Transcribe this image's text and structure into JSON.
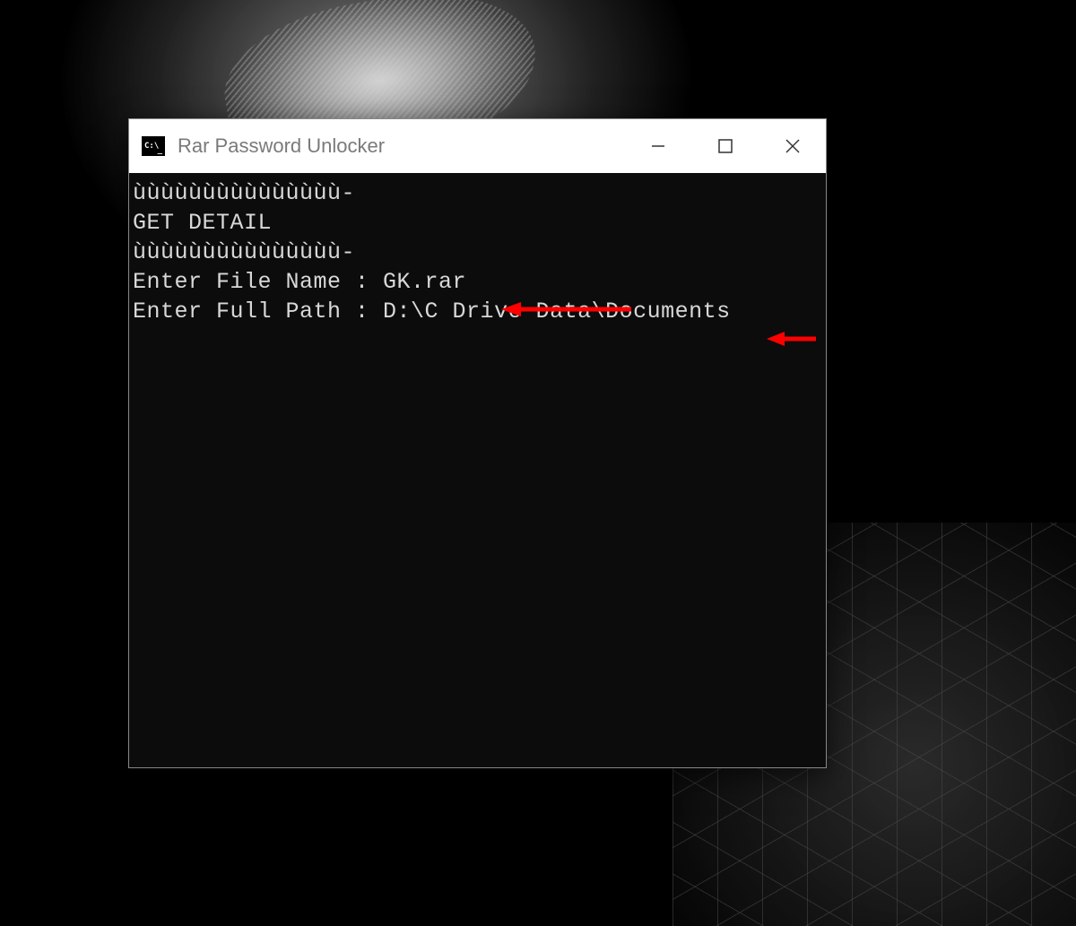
{
  "window": {
    "title": "Rar Password Unlocker",
    "icon_label": "C:\\"
  },
  "console": {
    "lines": [
      "ùùùùùùùùùùùùùùù-",
      "GET DETAIL",
      "ùùùùùùùùùùùùùùù-",
      "",
      "Enter File Name : GK.rar",
      "Enter Full Path : D:\\C Drive Data\\Documents"
    ]
  },
  "annotations": {
    "arrow1": {
      "points_to": "file-name-input"
    },
    "arrow2": {
      "points_to": "full-path-input"
    },
    "color": "#ff0000"
  }
}
